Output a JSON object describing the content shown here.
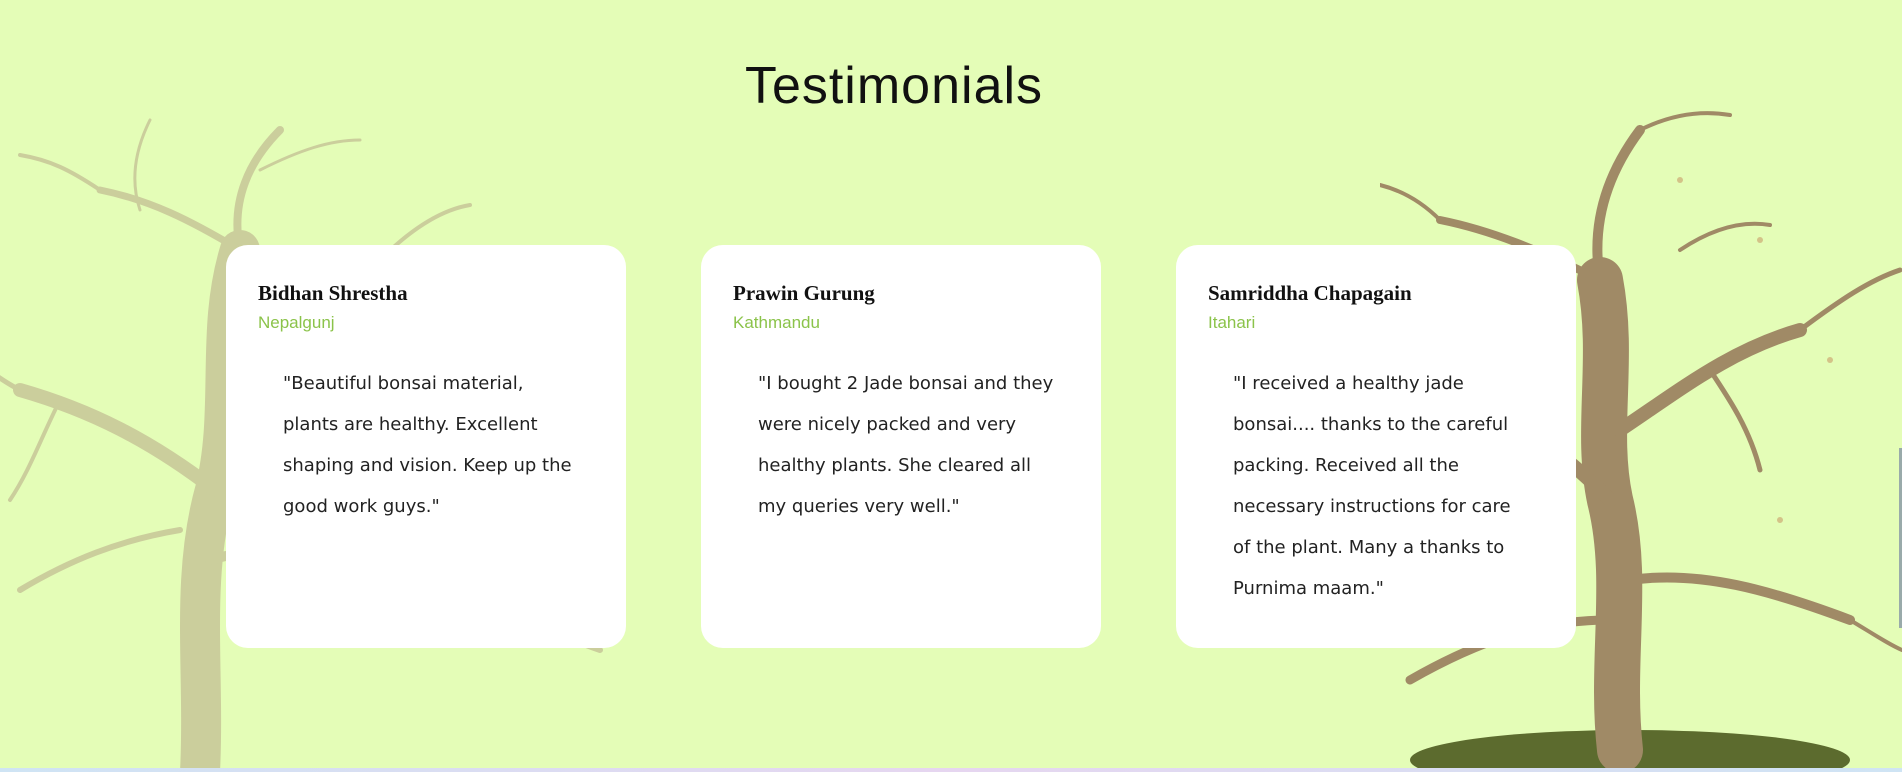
{
  "section": {
    "title": "Testimonials"
  },
  "testimonials": [
    {
      "name": "Bidhan Shrestha",
      "location": "Nepalgunj",
      "quote": "\"Beautiful bonsai material, plants are healthy. Excellent shaping and vision. Keep up the good work guys.\""
    },
    {
      "name": "Prawin Gurung",
      "location": "Kathmandu",
      "quote": "\"I bought 2 Jade bonsai and they were nicely packed and very healthy plants. She cleared all my queries very well.\""
    },
    {
      "name": "Samriddha Chapagain",
      "location": "Itahari",
      "quote": "\"I received a healthy jade bonsai.... thanks to the careful packing. Received all the necessary instructions for care of the plant. Many a thanks to Purnima maam.\""
    }
  ],
  "colors": {
    "background": "#e4fdb7",
    "card": "#ffffff",
    "location_accent": "#8bc34a"
  },
  "icons": [
    "bonsai-tree-left-image",
    "bonsai-tree-right-image"
  ]
}
